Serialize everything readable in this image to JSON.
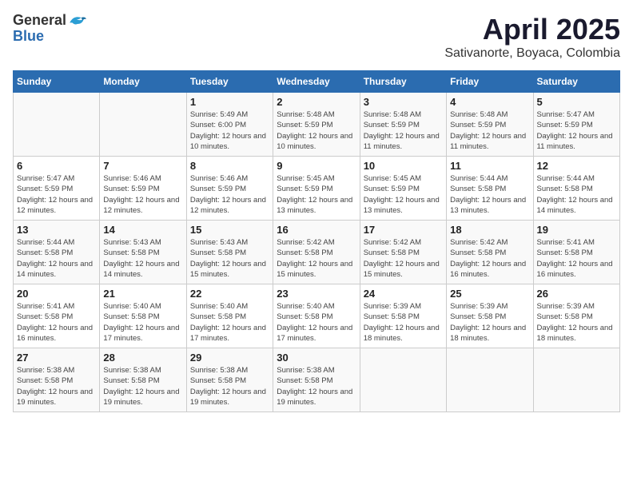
{
  "header": {
    "logo_general": "General",
    "logo_blue": "Blue",
    "title": "April 2025",
    "location": "Sativanorte, Boyaca, Colombia"
  },
  "weekdays": [
    "Sunday",
    "Monday",
    "Tuesday",
    "Wednesday",
    "Thursday",
    "Friday",
    "Saturday"
  ],
  "weeks": [
    [
      {
        "day": "",
        "content": ""
      },
      {
        "day": "",
        "content": ""
      },
      {
        "day": "1",
        "content": "Sunrise: 5:49 AM\nSunset: 6:00 PM\nDaylight: 12 hours and 10 minutes."
      },
      {
        "day": "2",
        "content": "Sunrise: 5:48 AM\nSunset: 5:59 PM\nDaylight: 12 hours and 10 minutes."
      },
      {
        "day": "3",
        "content": "Sunrise: 5:48 AM\nSunset: 5:59 PM\nDaylight: 12 hours and 11 minutes."
      },
      {
        "day": "4",
        "content": "Sunrise: 5:48 AM\nSunset: 5:59 PM\nDaylight: 12 hours and 11 minutes."
      },
      {
        "day": "5",
        "content": "Sunrise: 5:47 AM\nSunset: 5:59 PM\nDaylight: 12 hours and 11 minutes."
      }
    ],
    [
      {
        "day": "6",
        "content": "Sunrise: 5:47 AM\nSunset: 5:59 PM\nDaylight: 12 hours and 12 minutes."
      },
      {
        "day": "7",
        "content": "Sunrise: 5:46 AM\nSunset: 5:59 PM\nDaylight: 12 hours and 12 minutes."
      },
      {
        "day": "8",
        "content": "Sunrise: 5:46 AM\nSunset: 5:59 PM\nDaylight: 12 hours and 12 minutes."
      },
      {
        "day": "9",
        "content": "Sunrise: 5:45 AM\nSunset: 5:59 PM\nDaylight: 12 hours and 13 minutes."
      },
      {
        "day": "10",
        "content": "Sunrise: 5:45 AM\nSunset: 5:59 PM\nDaylight: 12 hours and 13 minutes."
      },
      {
        "day": "11",
        "content": "Sunrise: 5:44 AM\nSunset: 5:58 PM\nDaylight: 12 hours and 13 minutes."
      },
      {
        "day": "12",
        "content": "Sunrise: 5:44 AM\nSunset: 5:58 PM\nDaylight: 12 hours and 14 minutes."
      }
    ],
    [
      {
        "day": "13",
        "content": "Sunrise: 5:44 AM\nSunset: 5:58 PM\nDaylight: 12 hours and 14 minutes."
      },
      {
        "day": "14",
        "content": "Sunrise: 5:43 AM\nSunset: 5:58 PM\nDaylight: 12 hours and 14 minutes."
      },
      {
        "day": "15",
        "content": "Sunrise: 5:43 AM\nSunset: 5:58 PM\nDaylight: 12 hours and 15 minutes."
      },
      {
        "day": "16",
        "content": "Sunrise: 5:42 AM\nSunset: 5:58 PM\nDaylight: 12 hours and 15 minutes."
      },
      {
        "day": "17",
        "content": "Sunrise: 5:42 AM\nSunset: 5:58 PM\nDaylight: 12 hours and 15 minutes."
      },
      {
        "day": "18",
        "content": "Sunrise: 5:42 AM\nSunset: 5:58 PM\nDaylight: 12 hours and 16 minutes."
      },
      {
        "day": "19",
        "content": "Sunrise: 5:41 AM\nSunset: 5:58 PM\nDaylight: 12 hours and 16 minutes."
      }
    ],
    [
      {
        "day": "20",
        "content": "Sunrise: 5:41 AM\nSunset: 5:58 PM\nDaylight: 12 hours and 16 minutes."
      },
      {
        "day": "21",
        "content": "Sunrise: 5:40 AM\nSunset: 5:58 PM\nDaylight: 12 hours and 17 minutes."
      },
      {
        "day": "22",
        "content": "Sunrise: 5:40 AM\nSunset: 5:58 PM\nDaylight: 12 hours and 17 minutes."
      },
      {
        "day": "23",
        "content": "Sunrise: 5:40 AM\nSunset: 5:58 PM\nDaylight: 12 hours and 17 minutes."
      },
      {
        "day": "24",
        "content": "Sunrise: 5:39 AM\nSunset: 5:58 PM\nDaylight: 12 hours and 18 minutes."
      },
      {
        "day": "25",
        "content": "Sunrise: 5:39 AM\nSunset: 5:58 PM\nDaylight: 12 hours and 18 minutes."
      },
      {
        "day": "26",
        "content": "Sunrise: 5:39 AM\nSunset: 5:58 PM\nDaylight: 12 hours and 18 minutes."
      }
    ],
    [
      {
        "day": "27",
        "content": "Sunrise: 5:38 AM\nSunset: 5:58 PM\nDaylight: 12 hours and 19 minutes."
      },
      {
        "day": "28",
        "content": "Sunrise: 5:38 AM\nSunset: 5:58 PM\nDaylight: 12 hours and 19 minutes."
      },
      {
        "day": "29",
        "content": "Sunrise: 5:38 AM\nSunset: 5:58 PM\nDaylight: 12 hours and 19 minutes."
      },
      {
        "day": "30",
        "content": "Sunrise: 5:38 AM\nSunset: 5:58 PM\nDaylight: 12 hours and 19 minutes."
      },
      {
        "day": "",
        "content": ""
      },
      {
        "day": "",
        "content": ""
      },
      {
        "day": "",
        "content": ""
      }
    ]
  ]
}
